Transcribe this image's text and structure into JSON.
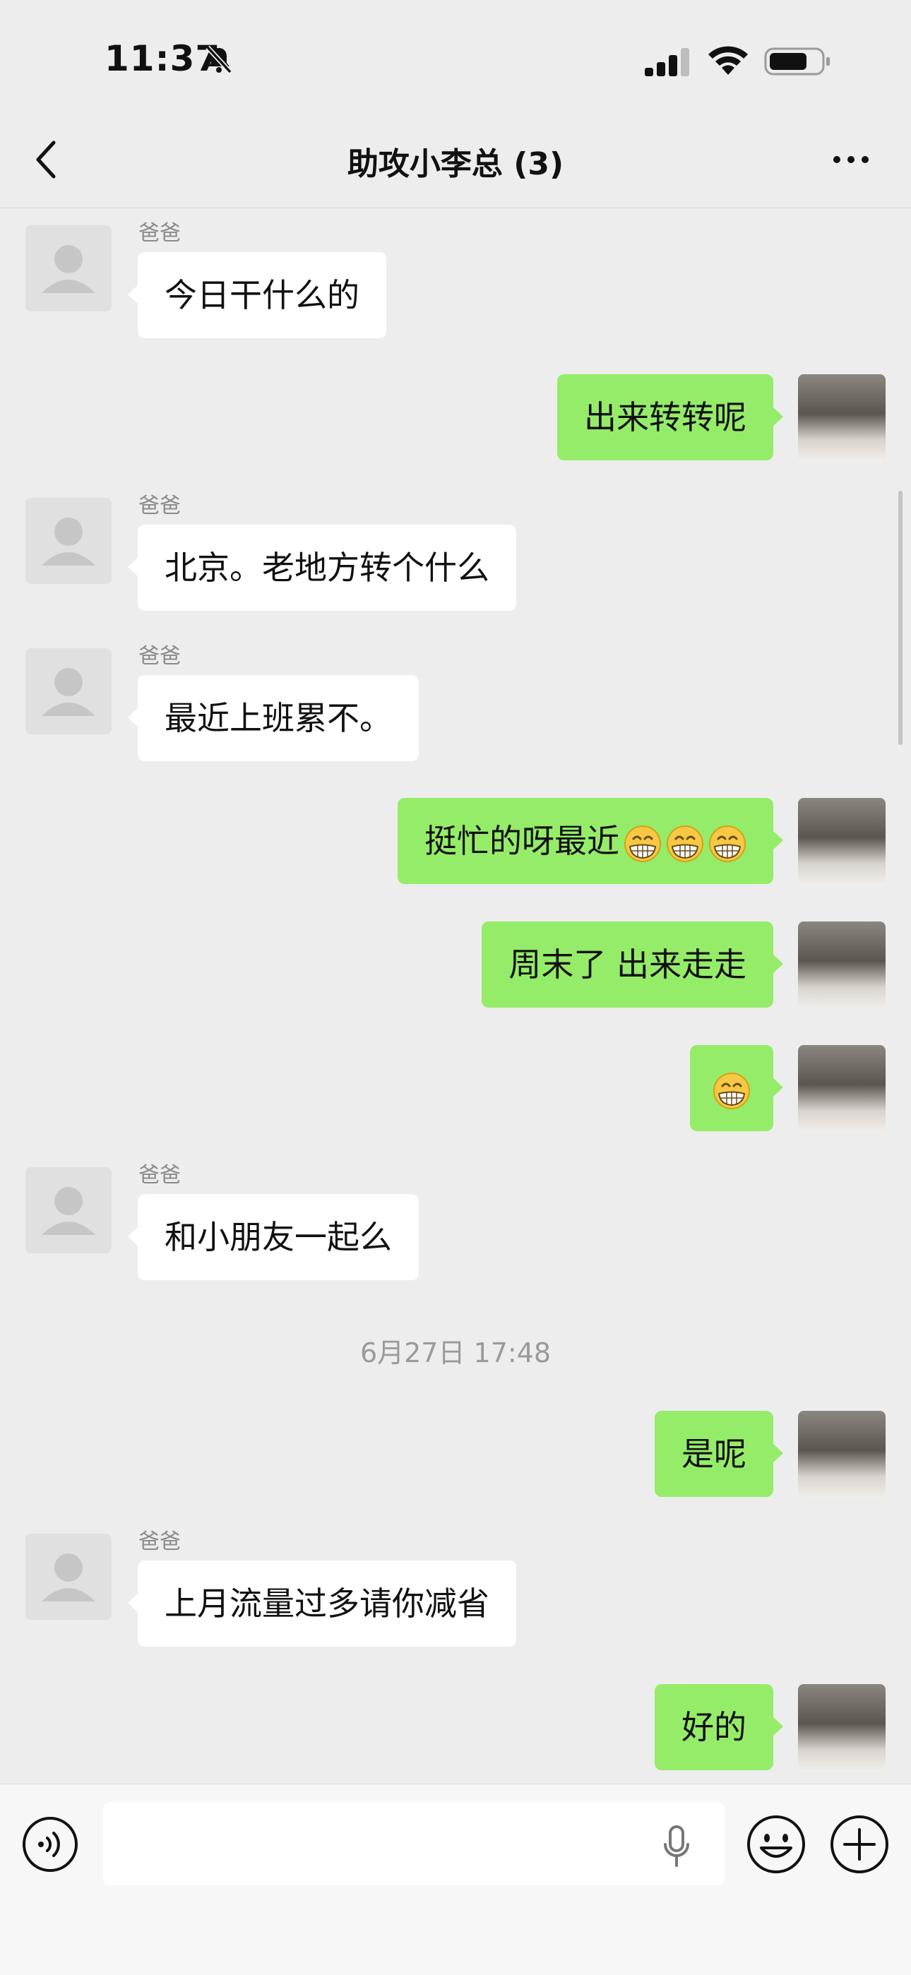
{
  "status_bar": {
    "time": "11:37"
  },
  "chat": {
    "title": "助攻小李总 (3)"
  },
  "messages": [
    {
      "side": "in",
      "sender": "爸爸",
      "text": "今日干什么的"
    },
    {
      "side": "out",
      "text": "出来转转呢"
    },
    {
      "side": "in",
      "sender": "爸爸",
      "text": "北京。老地方转个什么"
    },
    {
      "side": "in",
      "sender": "爸爸",
      "text": "最近上班累不。"
    },
    {
      "side": "out",
      "text": "挺忙的呀最近",
      "emoji_count": 3,
      "emoji": "grinning-face-icon"
    },
    {
      "side": "out",
      "text": "周末了 出来走走"
    },
    {
      "side": "out",
      "text": "",
      "emoji_count": 1,
      "emoji": "grinning-face-icon"
    },
    {
      "side": "in",
      "sender": "爸爸",
      "text": "和小朋友一起么"
    },
    {
      "side": "out",
      "text": "是呢"
    },
    {
      "side": "in",
      "sender": "爸爸",
      "text": "上月流量过多请你减省"
    },
    {
      "side": "out",
      "text": "好的"
    }
  ],
  "timestamp": "6月27日 17:48",
  "colors": {
    "outgoing_bubble": "#95ec69",
    "incoming_bubble": "#ffffff",
    "background": "#ededed"
  },
  "input": {
    "value": "",
    "placeholder": ""
  }
}
